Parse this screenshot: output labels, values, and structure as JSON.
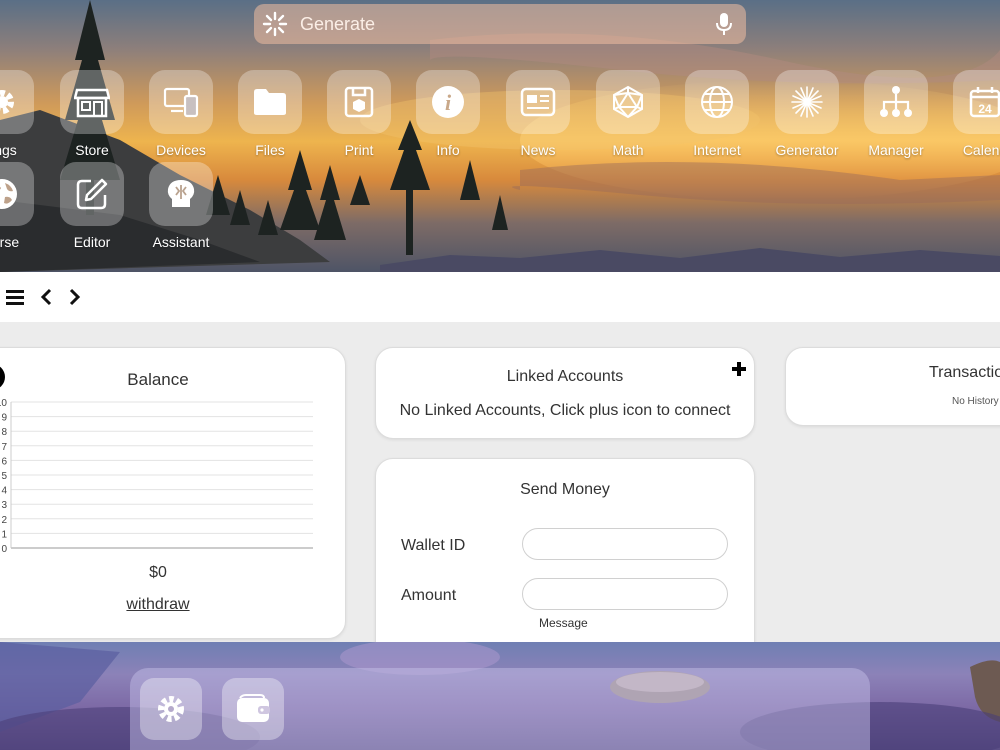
{
  "colors": {
    "card_bg": "#ffffff",
    "text": "#333333",
    "tile_bg": "rgba(255,255,255,0.30)"
  },
  "search": {
    "placeholder": "Generate",
    "icon_left": "sparkle-icon",
    "icon_right": "microphone-icon"
  },
  "apps_row1": [
    {
      "label": "tings",
      "icon": "gear-icon"
    },
    {
      "label": "Store",
      "icon": "store-icon"
    },
    {
      "label": "Devices",
      "icon": "devices-icon"
    },
    {
      "label": "Files",
      "icon": "folder-icon"
    },
    {
      "label": "Print",
      "icon": "print-icon"
    },
    {
      "label": "Info",
      "icon": "info-icon"
    },
    {
      "label": "News",
      "icon": "news-icon"
    },
    {
      "label": "Math",
      "icon": "icosahedron-icon"
    },
    {
      "label": "Internet",
      "icon": "globe-icon"
    },
    {
      "label": "Generator",
      "icon": "sparkle-icon"
    },
    {
      "label": "Manager",
      "icon": "hierarchy-icon"
    },
    {
      "label": "Calend",
      "icon": "calendar-icon",
      "badge": "24"
    }
  ],
  "apps_row2": [
    {
      "label": "verse",
      "icon": "earth-icon"
    },
    {
      "label": "Editor",
      "icon": "edit-icon"
    },
    {
      "label": "Assistant",
      "icon": "assistant-icon"
    }
  ],
  "nav": {
    "menu_icon": "hamburger-icon",
    "back_icon": "chevron-left-icon",
    "forward_icon": "chevron-right-icon"
  },
  "balance": {
    "title": "Balance",
    "amount": "$0",
    "withdraw_label": "withdraw",
    "y_ticks": [
      "10",
      "9",
      "8",
      "7",
      "6",
      "5",
      "4",
      "3",
      "2",
      "1",
      "0"
    ]
  },
  "chart_data": {
    "type": "line",
    "title": "Balance",
    "xlabel": "",
    "ylabel": "",
    "ylim": [
      0,
      10
    ],
    "y_ticks": [
      0,
      1,
      2,
      3,
      4,
      5,
      6,
      7,
      8,
      9,
      10
    ],
    "series": [],
    "grid": true
  },
  "linked_accounts": {
    "title": "Linked Accounts",
    "message": "No Linked Accounts, Click plus icon to connect",
    "add_icon": "plus-icon"
  },
  "transactions": {
    "title": "Transactio",
    "message": "No History"
  },
  "send_money": {
    "title": "Send Money",
    "wallet_label": "Wallet ID",
    "wallet_value": "",
    "amount_label": "Amount",
    "amount_value": "",
    "message_label": "Message"
  },
  "dock": [
    {
      "icon": "gear-icon"
    },
    {
      "icon": "wallet-icon"
    }
  ]
}
